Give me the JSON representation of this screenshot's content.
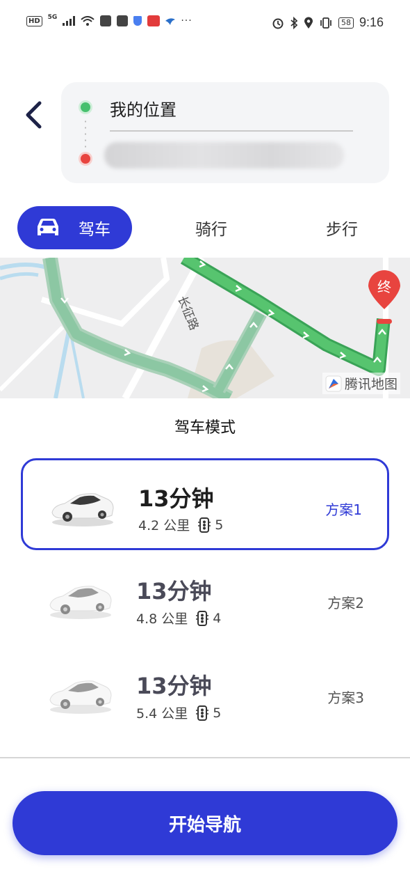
{
  "status_bar": {
    "left_indicators": [
      "HD",
      "5G"
    ],
    "battery": "58",
    "time": "9:16"
  },
  "route": {
    "origin": "我的位置",
    "destination": ""
  },
  "modes": {
    "drive": "驾车",
    "ride": "骑行",
    "walk": "步行",
    "active": "drive"
  },
  "map": {
    "road_label": "长征路",
    "end_marker": "终",
    "provider": "腾讯地图"
  },
  "section_title": "驾车模式",
  "plans": [
    {
      "time": "13分钟",
      "distance": "4.2 公里",
      "lights": "5",
      "name": "方案1",
      "selected": true
    },
    {
      "time": "13分钟",
      "distance": "4.8 公里",
      "lights": "4",
      "name": "方案2",
      "selected": false
    },
    {
      "time": "13分钟",
      "distance": "5.4 公里",
      "lights": "5",
      "name": "方案3",
      "selected": false
    }
  ],
  "start_button": "开始导航",
  "colors": {
    "accent": "#2f3ad6",
    "route_green": "#52c26a",
    "origin_dot": "#46c06e",
    "dest_dot": "#e8443f"
  }
}
